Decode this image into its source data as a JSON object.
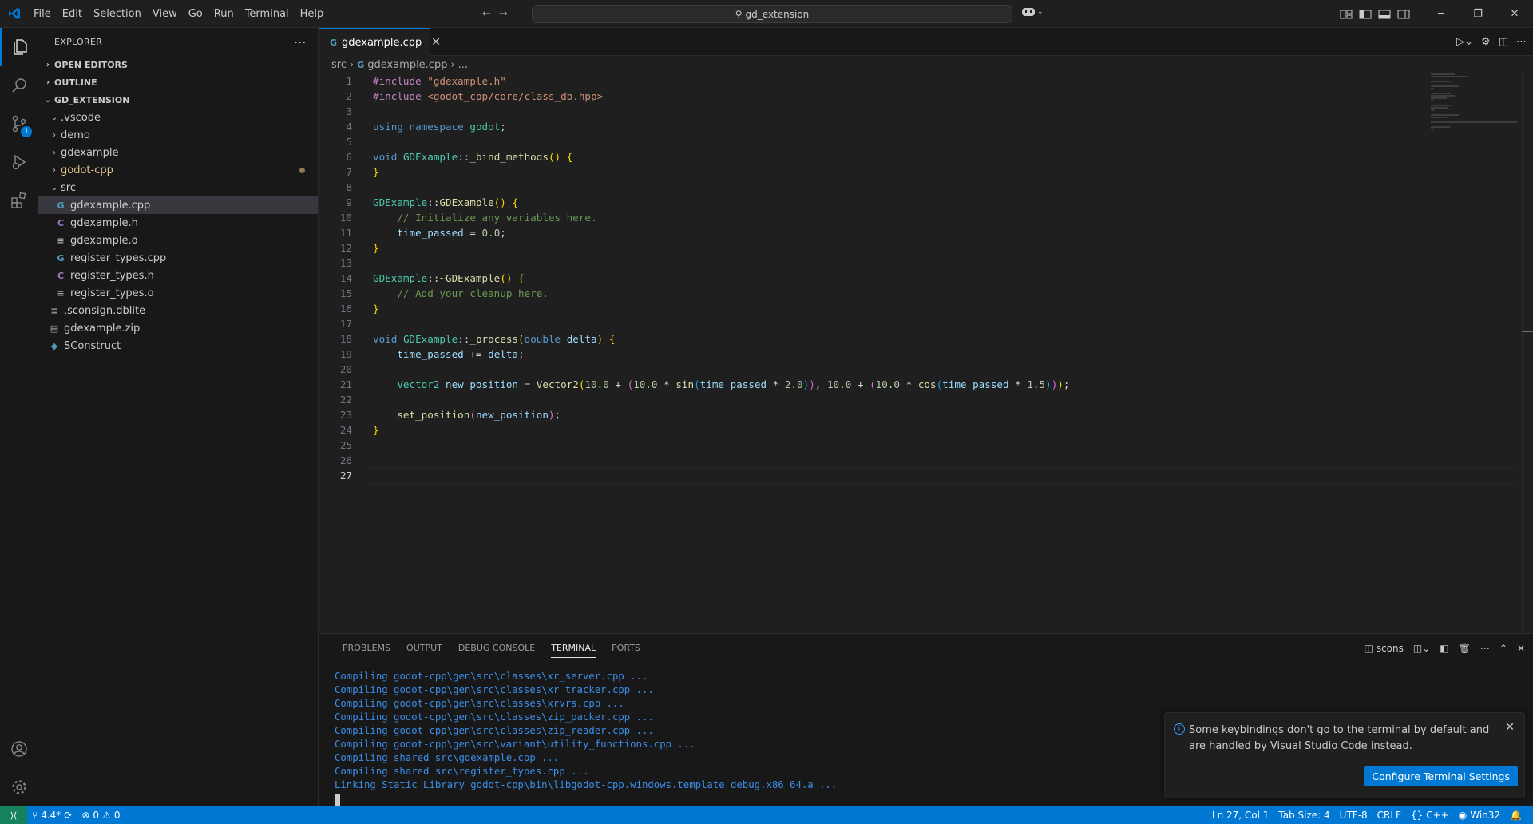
{
  "menu": [
    "File",
    "Edit",
    "Selection",
    "View",
    "Go",
    "Run",
    "Terminal",
    "Help"
  ],
  "command_center": "gd_extension",
  "explorer": {
    "title": "EXPLORER",
    "open_editors": "OPEN EDITORS",
    "outline": "OUTLINE",
    "project": "GD_EXTENSION",
    "tree": [
      {
        "label": ".vscode",
        "type": "folder"
      },
      {
        "label": "demo",
        "type": "folder"
      },
      {
        "label": "gdexample",
        "type": "folder"
      },
      {
        "label": "godot-cpp",
        "type": "folder"
      },
      {
        "label": "src",
        "type": "folder-open"
      },
      {
        "label": "gdexample.cpp",
        "type": "cpp"
      },
      {
        "label": "gdexample.h",
        "type": "h"
      },
      {
        "label": "gdexample.o",
        "type": "txt"
      },
      {
        "label": "register_types.cpp",
        "type": "cpp"
      },
      {
        "label": "register_types.h",
        "type": "h"
      },
      {
        "label": "register_types.o",
        "type": "txt"
      },
      {
        "label": ".sconsign.dblite",
        "type": "txt"
      },
      {
        "label": "gdexample.zip",
        "type": "zip"
      },
      {
        "label": "SConstruct",
        "type": "py"
      }
    ]
  },
  "scm_badge": "1",
  "editor": {
    "tab_label": "gdexample.cpp",
    "breadcrumb_src": "src",
    "breadcrumb_file": "gdexample.cpp",
    "breadcrumb_more": "...",
    "line_numbers": [
      "1",
      "2",
      "3",
      "4",
      "5",
      "6",
      "7",
      "8",
      "9",
      "10",
      "11",
      "12",
      "13",
      "14",
      "15",
      "16",
      "17",
      "18",
      "19",
      "20",
      "21",
      "22",
      "23",
      "24",
      "25",
      "26",
      "27"
    ]
  },
  "panel": {
    "tabs": [
      "PROBLEMS",
      "OUTPUT",
      "DEBUG CONSOLE",
      "TERMINAL",
      "PORTS"
    ],
    "terminal_name": "scons",
    "terminal_lines": [
      {
        "prefix": "Compiling ",
        "path": "godot-cpp\\gen\\src\\classes\\xr_server.cpp ..."
      },
      {
        "prefix": "Compiling ",
        "path": "godot-cpp\\gen\\src\\classes\\xr_tracker.cpp ..."
      },
      {
        "prefix": "Compiling ",
        "path": "godot-cpp\\gen\\src\\classes\\xrvrs.cpp ..."
      },
      {
        "prefix": "Compiling ",
        "path": "godot-cpp\\gen\\src\\classes\\zip_packer.cpp ..."
      },
      {
        "prefix": "Compiling ",
        "path": "godot-cpp\\gen\\src\\classes\\zip_reader.cpp ..."
      },
      {
        "prefix": "Compiling ",
        "path": "godot-cpp\\gen\\src\\variant\\utility_functions.cpp ..."
      },
      {
        "prefix": "Compiling shared ",
        "path": "src\\gdexample.cpp ..."
      },
      {
        "prefix": "Compiling shared ",
        "path": "src\\register_types.cpp ..."
      },
      {
        "prefix": "Linking Static Library ",
        "path": "godot-cpp\\bin\\libgodot-cpp.windows.template_debug.x86_64.a ..."
      }
    ]
  },
  "notification": {
    "message": "Some keybindings don't go to the terminal by default and are handled by Visual Studio Code instead.",
    "button": "Configure Terminal Settings"
  },
  "status": {
    "branch": "4.4*",
    "errors": "0",
    "warnings": "0",
    "position": "Ln 27, Col 1",
    "tab_size": "Tab Size: 4",
    "encoding": "UTF-8",
    "eol": "CRLF",
    "language": "C++",
    "platform": "Win32"
  },
  "colors": {
    "accent": "#0078d4",
    "remote": "#16825d"
  }
}
